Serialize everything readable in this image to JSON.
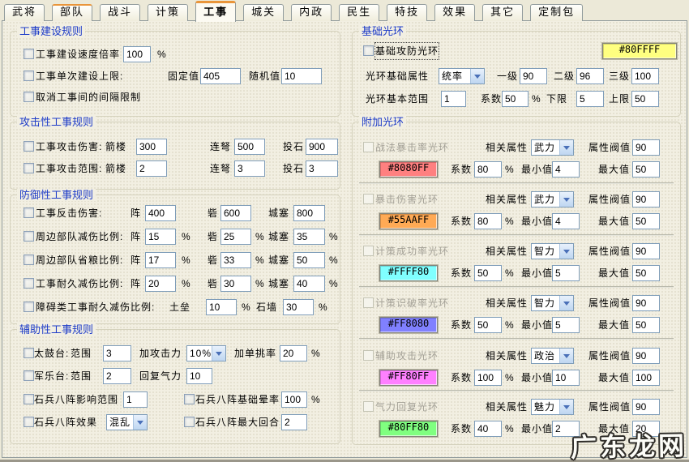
{
  "misc": {
    "percent": "%"
  },
  "tabs": {
    "items": [
      "武将",
      "部队",
      "战斗",
      "计策",
      "工事",
      "城关",
      "内政",
      "民生",
      "特技",
      "效果",
      "其它",
      "定制包"
    ],
    "active": "工事"
  },
  "g1": {
    "title": "工事建设规则",
    "r1": {
      "label": "工事建设速度倍率",
      "value": "100"
    },
    "r2": {
      "label": "工事单次建设上限:",
      "f1": "固定值",
      "v1": "405",
      "f2": "随机值",
      "v2": "10"
    },
    "r3": {
      "label": "取消工事间的间隔限制"
    }
  },
  "g2": {
    "title": "攻击性工事规则",
    "c1": "箭楼",
    "c2": "连弩",
    "c3": "投石",
    "r1": {
      "label": "工事攻击伤害:",
      "v1": "300",
      "v2": "500",
      "v3": "900"
    },
    "r2": {
      "label": "工事攻击范围:",
      "v1": "2",
      "v2": "3",
      "v3": "3"
    }
  },
  "g3": {
    "title": "防御性工事规则",
    "c1": "阵",
    "c2": "砦",
    "c3": "城塞",
    "r1": {
      "label": "工事反击伤害:",
      "v1": "400",
      "v2": "600",
      "v3": "800"
    },
    "r2": {
      "label": "周边部队减伤比例:",
      "v1": "15",
      "v2": "25",
      "v3": "35"
    },
    "r3": {
      "label": "周边部队省粮比例:",
      "v1": "17",
      "v2": "33",
      "v3": "50"
    },
    "r4": {
      "label": "工事耐久减伤比例:",
      "v1": "20",
      "v2": "30",
      "v3": "40"
    },
    "r5": {
      "label": "障碍类工事耐久减伤比例:",
      "f1": "土垒",
      "v1": "10",
      "f2": "石墙",
      "v2": "30"
    }
  },
  "g4": {
    "title": "辅助性工事规则",
    "r1": {
      "label": "太鼓台:",
      "f1": "范围",
      "v1": "3",
      "f2": "加攻击力",
      "dd": "10%",
      "f3": "加单挑率",
      "v3": "20"
    },
    "r2": {
      "label": "军乐台:",
      "f1": "范围",
      "v1": "2",
      "f2": "回复气力",
      "v2": "10"
    },
    "r3": {
      "label1": "石兵八阵影响范围",
      "v1": "1",
      "label2": "石兵八阵基础晕率",
      "v2": "100"
    },
    "r4": {
      "label1": "石兵八阵效果",
      "dd": "混乱",
      "label2": "石兵八阵最大回合",
      "v2": "2"
    }
  },
  "g5": {
    "title": "基础光环",
    "r1": {
      "label": "基础攻防光环",
      "swatch": "#80FFFF",
      "swatch_bg": "#FFFF80"
    },
    "r2": {
      "label": "光环基础属性",
      "dd": "统率",
      "f1": "一级",
      "v1": "90",
      "f2": "二级",
      "v2": "96",
      "f3": "三级",
      "v3": "100"
    },
    "r3": {
      "label": "光环基本范围",
      "v0": "1",
      "f1": "系数",
      "v1": "50",
      "f2": "下限",
      "v2": "5",
      "f3": "上限",
      "v3": "50"
    }
  },
  "g6": {
    "title": "附加光环",
    "labels": {
      "attr": "相关属性",
      "threshold": "属性阀值",
      "coeff": "系数",
      "min": "最小值",
      "max": "最大值"
    },
    "auras": [
      {
        "name": "战法暴击率光环",
        "attr": "武力",
        "threshold": "90",
        "swatch": "#8080FF",
        "swatch_bg": "#FF8080",
        "coeff": "80",
        "min": "4",
        "max": "50"
      },
      {
        "name": "暴击伤害光环",
        "attr": "武力",
        "threshold": "90",
        "swatch": "#55AAFF",
        "swatch_bg": "#FFAA55",
        "coeff": "80",
        "min": "4",
        "max": "50"
      },
      {
        "name": "计策成功率光环",
        "attr": "智力",
        "threshold": "90",
        "swatch": "#FFFF80",
        "swatch_bg": "#80FFFF",
        "coeff": "50",
        "min": "5",
        "max": "50"
      },
      {
        "name": "计策识破率光环",
        "attr": "智力",
        "threshold": "90",
        "swatch": "#FF8080",
        "swatch_bg": "#8080FF",
        "coeff": "50",
        "min": "5",
        "max": "50"
      },
      {
        "name": "辅助攻击光环",
        "attr": "政治",
        "threshold": "90",
        "swatch": "#FF80FF",
        "swatch_bg": "#FF80FF",
        "coeff": "100",
        "min": "10",
        "max": "100"
      },
      {
        "name": "气力回复光环",
        "attr": "魅力",
        "threshold": "90",
        "swatch": "#80FF80",
        "swatch_bg": "#80FF80",
        "coeff": "40",
        "min": "2",
        "max": "20"
      }
    ]
  },
  "watermark": "广东龙网"
}
